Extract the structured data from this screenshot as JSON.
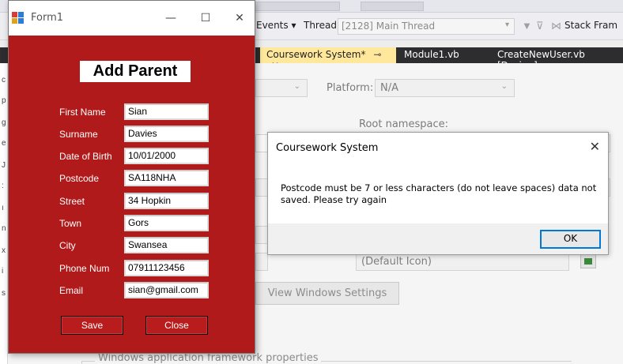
{
  "vs": {
    "toolbar": {
      "events_label": "Events ▾",
      "thread_label": "Thread:",
      "thread_value": "[2128] Main Thread",
      "stack_label": "Stack Fram"
    },
    "tabs": [
      {
        "label": "Coursework System*"
      },
      {
        "label": "Module1.vb"
      },
      {
        "label": "CreateNewUser.vb [Design]"
      }
    ],
    "props": {
      "platform_label": "Platform:",
      "platform_value": "N/A",
      "root_namespace_label": "Root namespace:",
      "icon_value": "(Default Icon)",
      "view_windows_settings": "View Windows Settings",
      "framework_group_label": "Windows application framework properties"
    }
  },
  "form1": {
    "title": "Form1",
    "heading": "Add Parent",
    "fields": [
      {
        "label": "First Name",
        "value": "Sian"
      },
      {
        "label": "Surname",
        "value": "Davies"
      },
      {
        "label": "Date of Birth",
        "value": "10/01/2000"
      },
      {
        "label": "Postcode",
        "value": "SA118NHA"
      },
      {
        "label": "Street",
        "value": "34 Hopkin"
      },
      {
        "label": "Town",
        "value": "Gors"
      },
      {
        "label": "City",
        "value": "Swansea"
      },
      {
        "label": "Phone Num",
        "value": "07911123456"
      },
      {
        "label": "Email",
        "value": "sian@gmail.com"
      }
    ],
    "save_label": "Save",
    "close_label": "Close",
    "background_color": "#b11a1a"
  },
  "msgbox": {
    "title": "Coursework System",
    "message": "Postcode must be 7 or less characters (do not leave spaces) data not saved. Please try again",
    "ok_label": "OK"
  }
}
